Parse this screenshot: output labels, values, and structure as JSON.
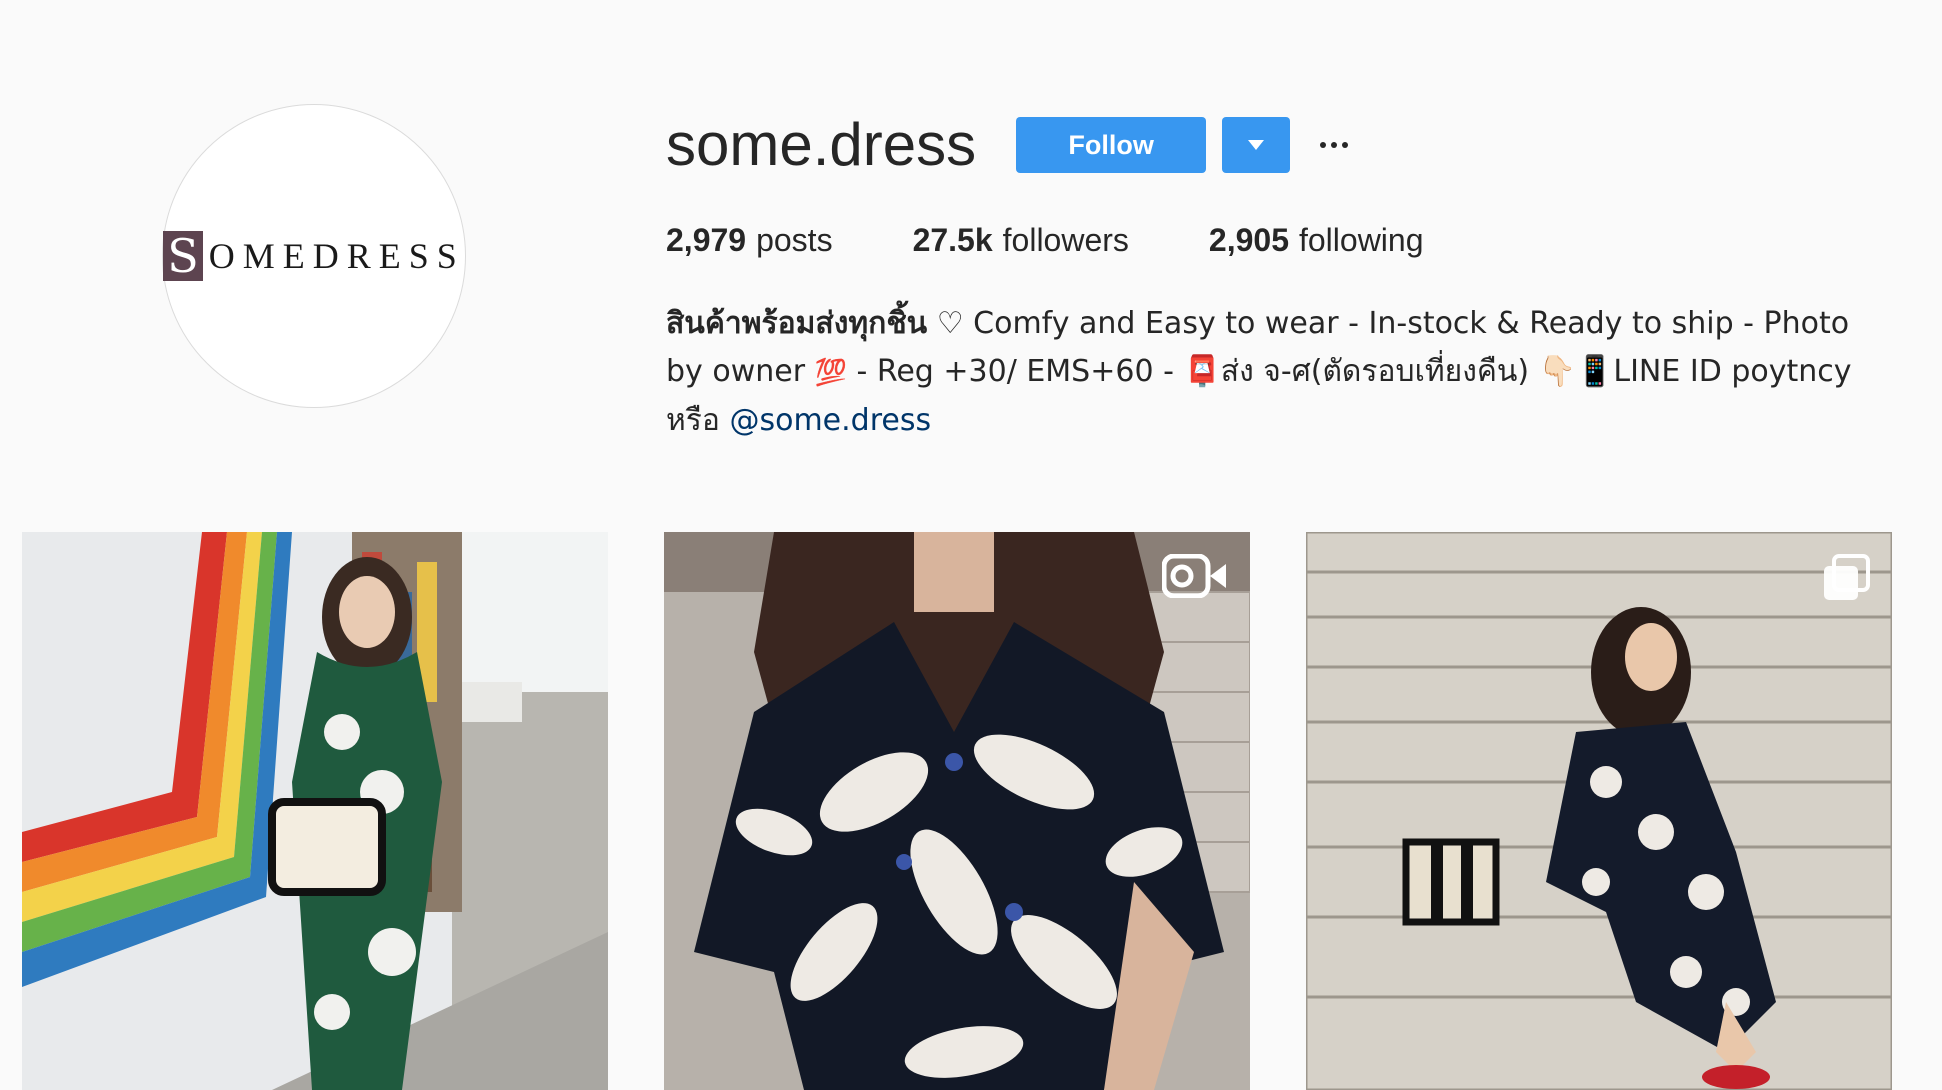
{
  "profile": {
    "username": "some.dress",
    "avatar_logo_first": "S",
    "avatar_logo_rest": "OMEDRESS",
    "follow_label": "Follow"
  },
  "stats": {
    "posts_count": "2,979",
    "posts_label": "posts",
    "followers_count": "27.5k",
    "followers_label": "followers",
    "following_count": "2,905",
    "following_label": "following"
  },
  "bio": {
    "line1_bold": "สินค้าพร้อมส่งทุกชิ้น",
    "line1_rest": " ♡ Comfy and Easy to wear - In-stock & Ready to ship - Photo",
    "line2_a": "by owner ",
    "line2_emoji_100": "💯",
    "line2_b": " - Reg +30/ EMS+60 - ",
    "line2_emoji_mailbox": "📮",
    "line2_c": "ส่ง จ-ศ(ตัดรอบเที่ยงคืน) ",
    "line2_emoji_hand": "👇🏻",
    "line2_emoji_phone": "📱",
    "line2_d": "LINE ID poytncy",
    "line3_a": "หรือ ",
    "line3_mention": "@some.dress"
  },
  "posts": [
    {
      "kind": "photo",
      "icon": "none"
    },
    {
      "kind": "video",
      "icon": "video-icon"
    },
    {
      "kind": "album",
      "icon": "carousel-icon"
    }
  ],
  "colors": {
    "accent": "#3897f0",
    "background": "#fafafa",
    "mention": "#003569",
    "logo_block": "#5d4450"
  }
}
